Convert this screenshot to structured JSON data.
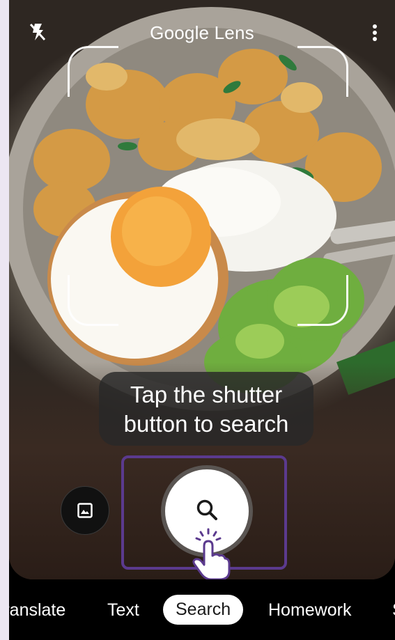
{
  "header": {
    "title": "Google Lens",
    "flash_icon": "flash-off-icon",
    "menu_icon": "more-vert-icon"
  },
  "hint": {
    "line1": "Tap the shutter",
    "line2": "button to search"
  },
  "controls": {
    "gallery_icon": "image-icon",
    "shutter_icon": "search-icon",
    "pointer_icon": "tap-hand-icon"
  },
  "modes": [
    {
      "label": "Translate",
      "active": false
    },
    {
      "label": "Text",
      "active": false
    },
    {
      "label": "Search",
      "active": true
    },
    {
      "label": "Homework",
      "active": false
    },
    {
      "label": "S",
      "active": false
    }
  ],
  "colors": {
    "highlight": "#5b3a8e",
    "background": "#ece6f2"
  }
}
